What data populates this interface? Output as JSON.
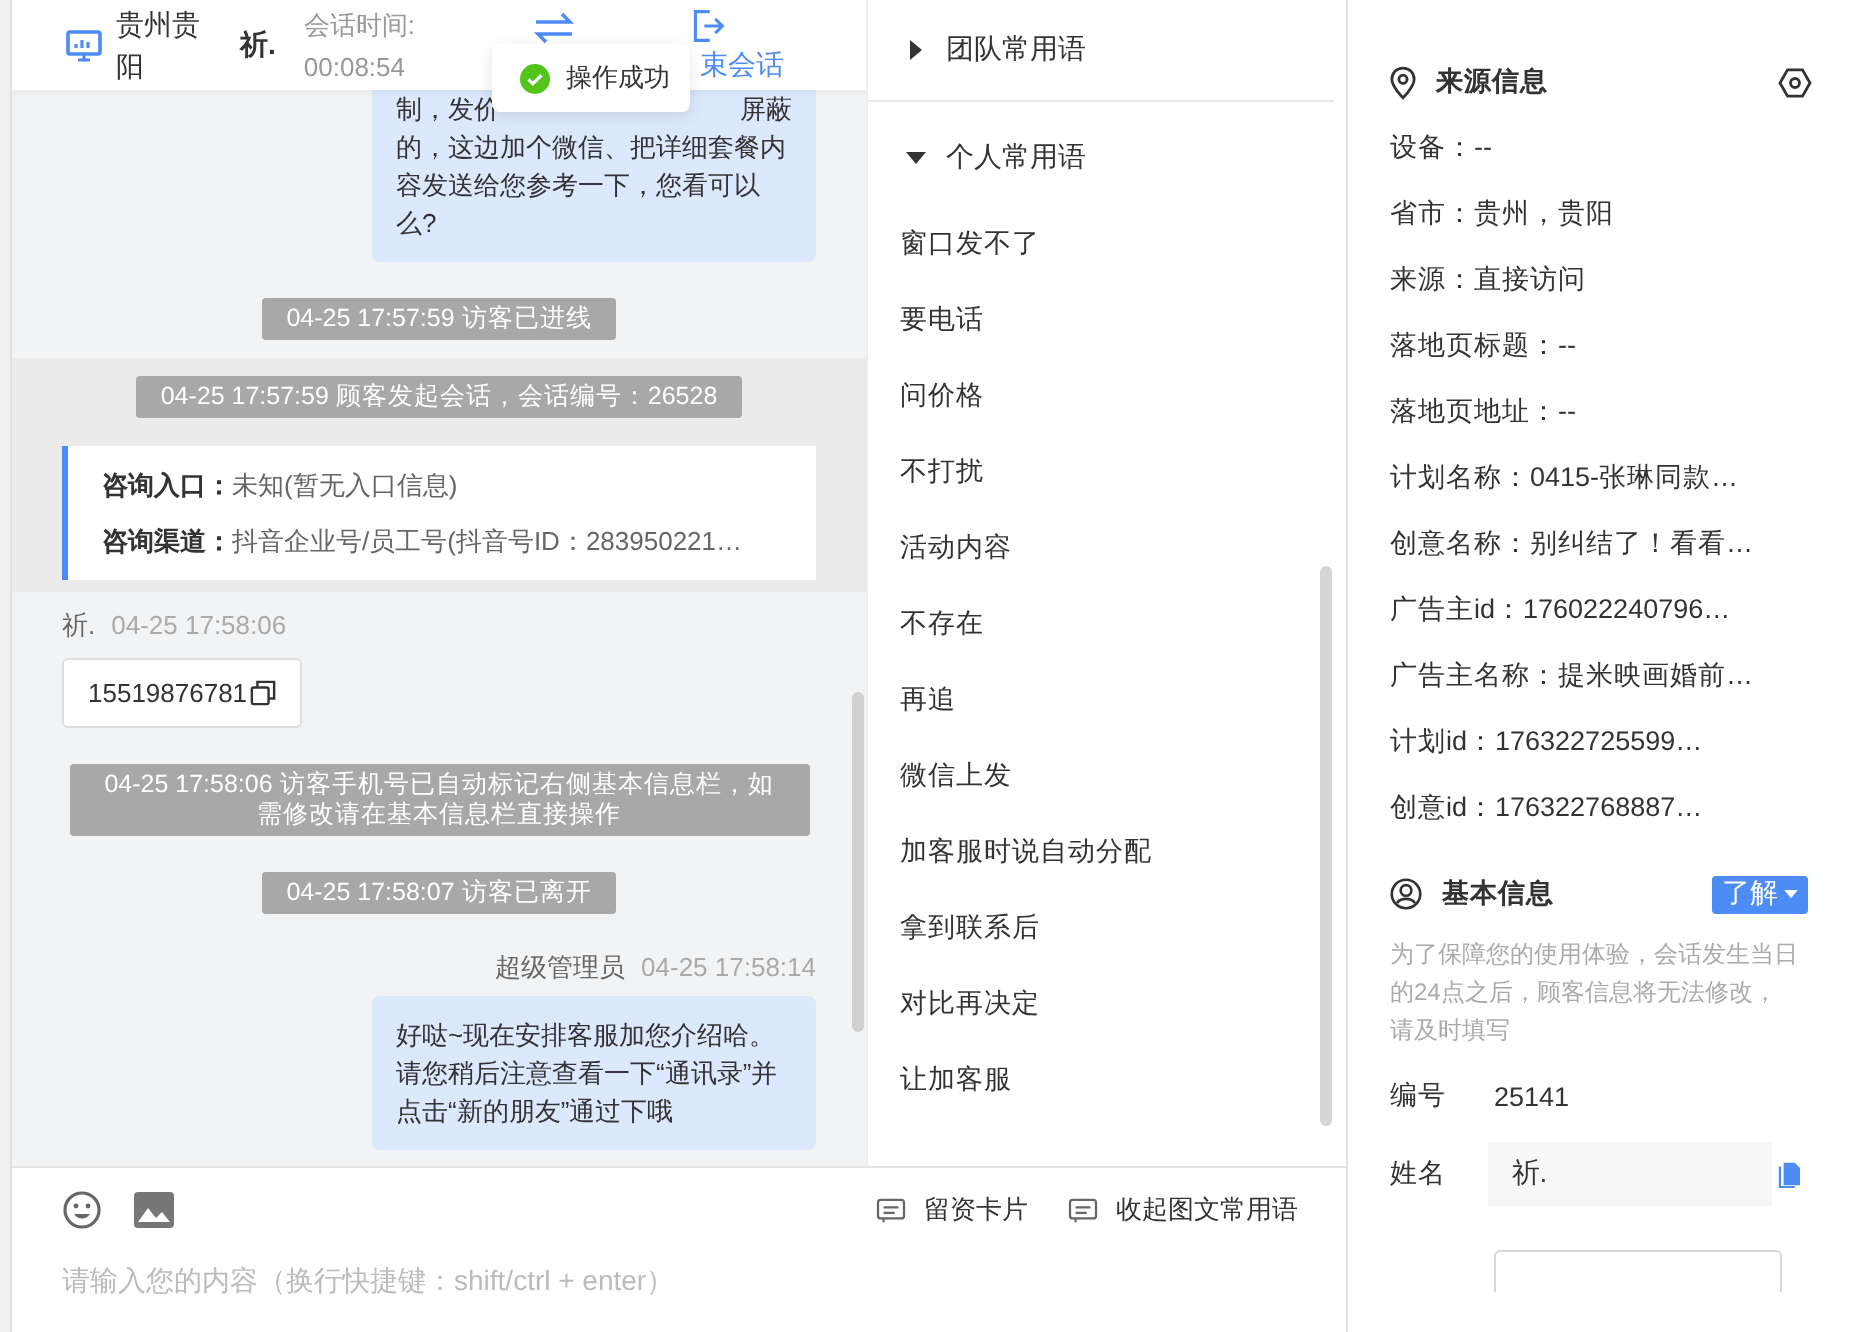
{
  "header": {
    "location": "贵州贵阳",
    "visitor": "祈.",
    "duration_label": "会话时间:",
    "duration": "00:08:54",
    "end_label": "束会话"
  },
  "toast": {
    "kind": "success",
    "text": "操作成功"
  },
  "messages": [
    {
      "kind": "agent_partial",
      "top_left": "制，发价",
      "top_right": "屏蔽",
      "lines": [
        "的，这边加个微信、把详细套餐内",
        "容发送给您参考一下，您看可以",
        "么?"
      ]
    },
    {
      "kind": "system",
      "text": "04-25 17:57:59 访客已进线"
    },
    {
      "kind": "session_start",
      "text": "04-25 17:57:59 顾客发起会话，会话编号：26528",
      "fields": [
        {
          "label": "咨询入口：",
          "value": "未知(暂无入口信息)"
        },
        {
          "label": "咨询渠道：",
          "value": "抖音企业号/员工号(抖音号ID：283950221…"
        }
      ]
    },
    {
      "kind": "visitor",
      "name": "祈.",
      "time": "04-25 17:58:06",
      "text": "15519876781"
    },
    {
      "kind": "system",
      "text": "04-25 17:58:06 访客手机号已自动标记右侧基本信息栏，如需修改请在基本信息栏直接操作"
    },
    {
      "kind": "system",
      "text": "04-25 17:58:07 访客已离开"
    },
    {
      "kind": "agent",
      "name": "超级管理员",
      "time": "04-25 17:58:14",
      "lines": [
        "好哒~现在安排客服加您介绍哈。",
        "请您稍后注意查看一下“通讯录”并",
        "点击“新的朋友”通过下哦"
      ]
    }
  ],
  "phrase_groups": [
    {
      "title": "团队常用语",
      "expanded": false
    },
    {
      "title": "个人常用语",
      "expanded": true,
      "items": [
        "窗口发不了",
        "要电话",
        "问价格",
        "不打扰",
        "活动内容",
        "不存在",
        "再追",
        "微信上发",
        "加客服时说自动分配",
        "拿到联系后",
        "对比再决定",
        "让加客服"
      ]
    }
  ],
  "composer": {
    "placeholder": "请输入您的内容（换行快捷键：shift/ctrl + enter）",
    "actions": [
      "留资卡片",
      "收起图文常用语"
    ]
  },
  "source_info": {
    "title": "来源信息",
    "rows": [
      "设备：--",
      "省市：贵州，贵阳",
      "来源：直接访问",
      "落地页标题：--",
      "落地页地址：--",
      "计划名称：0415-张琳同款…",
      "创意名称：别纠结了！看看…",
      "广告主id：176022240796…",
      "广告主名称：提米映画婚前…",
      "计划id：176322725599…",
      "创意id：176322768887…"
    ]
  },
  "basic_info": {
    "title": "基本信息",
    "button": "了解",
    "note": "为了保障您的使用体验，会话发生当日的24点之后，顾客信息将无法修改，请及时填写",
    "fields": [
      {
        "kind": "text",
        "label": "编号",
        "value": "25141"
      },
      {
        "kind": "input",
        "label": "姓名",
        "value": "祈."
      }
    ]
  }
}
